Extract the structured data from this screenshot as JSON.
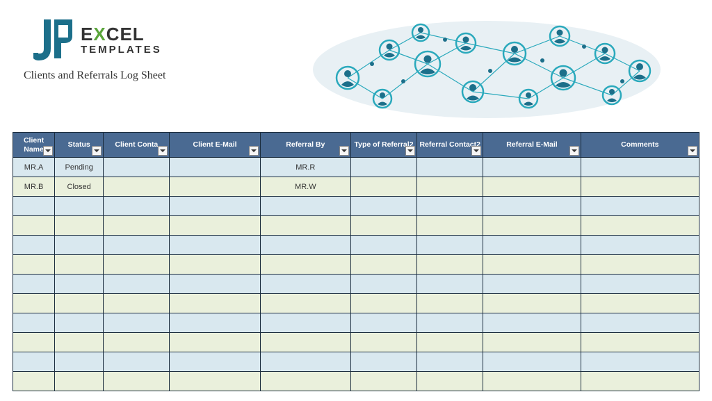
{
  "logo": {
    "word1_part1": "E",
    "word1_x": "X",
    "word1_part2": "CEL",
    "word2": "TEMPLATES"
  },
  "subtitle": "Clients and Referrals Log Sheet",
  "columns": [
    "Client Name",
    "Status",
    "Client Conta",
    "Client E-Mail",
    "Referral By",
    "Type of Referral2",
    "Referral Contact2",
    "Referral E-Mail",
    "Comments"
  ],
  "rows": [
    {
      "client_name": "MR.A",
      "status": "Pending",
      "client_contact": "",
      "client_email": "",
      "referral_by": "MR.R",
      "type_of_referral": "",
      "referral_contact": "",
      "referral_email": "",
      "comments": ""
    },
    {
      "client_name": "MR.B",
      "status": "Closed",
      "client_contact": "",
      "client_email": "",
      "referral_by": "MR.W",
      "type_of_referral": "",
      "referral_contact": "",
      "referral_email": "",
      "comments": ""
    },
    {
      "client_name": "",
      "status": "",
      "client_contact": "",
      "client_email": "",
      "referral_by": "",
      "type_of_referral": "",
      "referral_contact": "",
      "referral_email": "",
      "comments": ""
    },
    {
      "client_name": "",
      "status": "",
      "client_contact": "",
      "client_email": "",
      "referral_by": "",
      "type_of_referral": "",
      "referral_contact": "",
      "referral_email": "",
      "comments": ""
    },
    {
      "client_name": "",
      "status": "",
      "client_contact": "",
      "client_email": "",
      "referral_by": "",
      "type_of_referral": "",
      "referral_contact": "",
      "referral_email": "",
      "comments": ""
    },
    {
      "client_name": "",
      "status": "",
      "client_contact": "",
      "client_email": "",
      "referral_by": "",
      "type_of_referral": "",
      "referral_contact": "",
      "referral_email": "",
      "comments": ""
    },
    {
      "client_name": "",
      "status": "",
      "client_contact": "",
      "client_email": "",
      "referral_by": "",
      "type_of_referral": "",
      "referral_contact": "",
      "referral_email": "",
      "comments": ""
    },
    {
      "client_name": "",
      "status": "",
      "client_contact": "",
      "client_email": "",
      "referral_by": "",
      "type_of_referral": "",
      "referral_contact": "",
      "referral_email": "",
      "comments": ""
    },
    {
      "client_name": "",
      "status": "",
      "client_contact": "",
      "client_email": "",
      "referral_by": "",
      "type_of_referral": "",
      "referral_contact": "",
      "referral_email": "",
      "comments": ""
    },
    {
      "client_name": "",
      "status": "",
      "client_contact": "",
      "client_email": "",
      "referral_by": "",
      "type_of_referral": "",
      "referral_contact": "",
      "referral_email": "",
      "comments": ""
    },
    {
      "client_name": "",
      "status": "",
      "client_contact": "",
      "client_email": "",
      "referral_by": "",
      "type_of_referral": "",
      "referral_contact": "",
      "referral_email": "",
      "comments": ""
    },
    {
      "client_name": "",
      "status": "",
      "client_contact": "",
      "client_email": "",
      "referral_by": "",
      "type_of_referral": "",
      "referral_contact": "",
      "referral_email": "",
      "comments": ""
    }
  ]
}
